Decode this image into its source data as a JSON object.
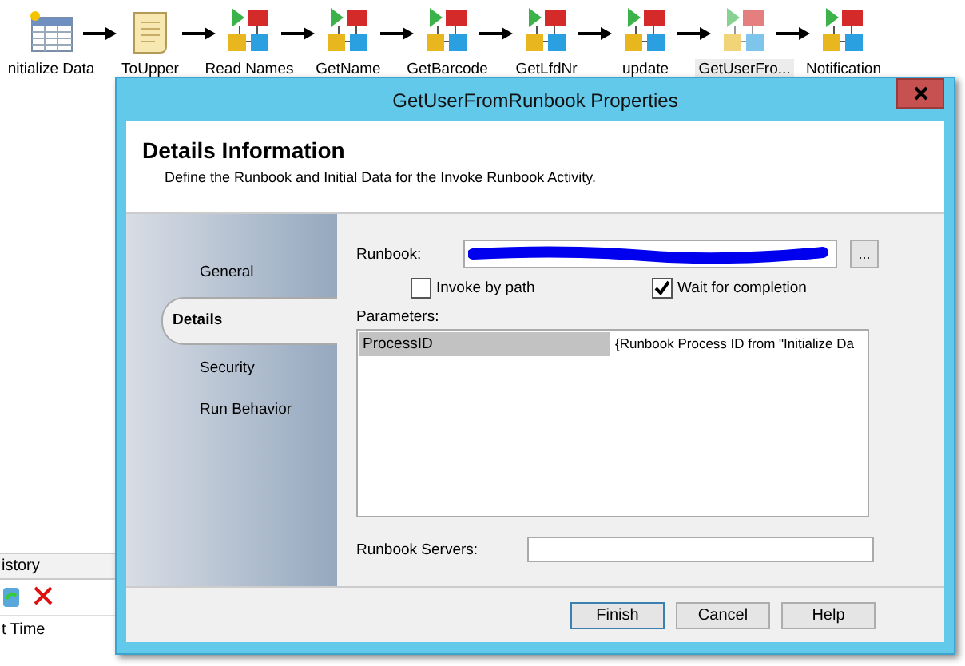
{
  "workflow": {
    "activities": [
      {
        "label": "nitialize Data",
        "kind": "table",
        "selected": false
      },
      {
        "label": "ToUpper",
        "kind": "script",
        "selected": false
      },
      {
        "label": "Read Names",
        "kind": "runbook",
        "selected": false
      },
      {
        "label": "GetName",
        "kind": "runbook",
        "selected": false
      },
      {
        "label": "GetBarcode",
        "kind": "runbook",
        "selected": false
      },
      {
        "label": "GetLfdNr",
        "kind": "runbook",
        "selected": false
      },
      {
        "label": "update",
        "kind": "runbook",
        "selected": false
      },
      {
        "label": "GetUserFro...",
        "kind": "runbook",
        "selected": true
      },
      {
        "label": "Notification",
        "kind": "runbook",
        "selected": false
      }
    ]
  },
  "history": {
    "title": "istory",
    "column": "t Time"
  },
  "dialog": {
    "title": "GetUserFromRunbook Properties",
    "heading": "Details Information",
    "description": "Define the Runbook and Initial Data for the Invoke Runbook Activity.",
    "nav": [
      {
        "label": "General",
        "selected": false
      },
      {
        "label": "Details",
        "selected": true
      },
      {
        "label": "Security",
        "selected": false
      },
      {
        "label": "Run Behavior",
        "selected": false
      }
    ],
    "runbook_label": "Runbook:",
    "browse": "...",
    "options": [
      {
        "label": "Invoke by path",
        "checked": false
      },
      {
        "label": "Wait for completion",
        "checked": true
      }
    ],
    "parameters_label": "Parameters:",
    "parameters": [
      {
        "name": "ProcessID",
        "value": "{Runbook Process ID from \"Initialize Da"
      }
    ],
    "servers_label": "Runbook Servers:",
    "buttons": [
      "Finish",
      "Cancel",
      "Help"
    ]
  }
}
